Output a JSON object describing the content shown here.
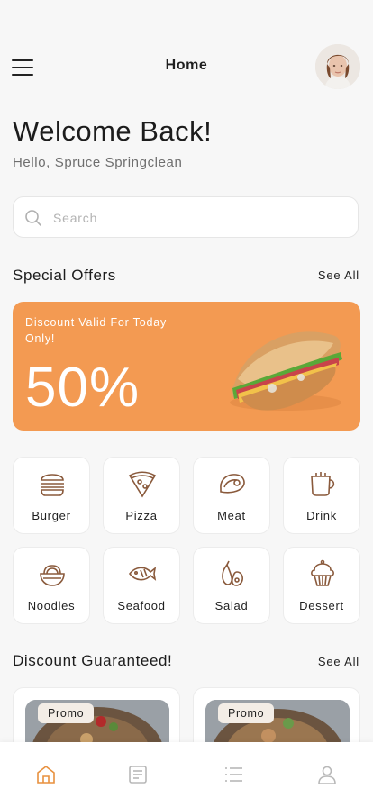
{
  "header": {
    "title": "Home",
    "avatar_icon": "user-avatar-photo"
  },
  "welcome": {
    "title": "Welcome Back!",
    "subtitle": "Hello, Spruce Springclean"
  },
  "search": {
    "placeholder": "Search",
    "icon": "search-icon"
  },
  "special_offers": {
    "title": "Special Offers",
    "see_all": "See All",
    "banner": {
      "subtitle": "Discount Valid For Today Only!",
      "discount": "50%",
      "color": "#f39a52"
    }
  },
  "categories": [
    {
      "label": "Burger",
      "icon": "burger-icon"
    },
    {
      "label": "Pizza",
      "icon": "pizza-icon"
    },
    {
      "label": "Meat",
      "icon": "meat-icon"
    },
    {
      "label": "Drink",
      "icon": "drink-icon"
    },
    {
      "label": "Noodles",
      "icon": "noodles-icon"
    },
    {
      "label": "Seafood",
      "icon": "fish-icon"
    },
    {
      "label": "Salad",
      "icon": "salad-icon"
    },
    {
      "label": "Dessert",
      "icon": "cupcake-icon"
    }
  ],
  "discount_guaranteed": {
    "title": "Discount Guaranteed!",
    "see_all": "See All",
    "cards": [
      {
        "tag": "Promo"
      },
      {
        "tag": "Promo"
      }
    ]
  },
  "bottom_nav": {
    "items": [
      {
        "icon": "home-icon",
        "active": true
      },
      {
        "icon": "receipt-icon",
        "active": false
      },
      {
        "icon": "list-icon",
        "active": false
      },
      {
        "icon": "profile-icon",
        "active": false
      }
    ],
    "active_color": "#e8913f",
    "inactive_color": "#b8b8b8"
  }
}
